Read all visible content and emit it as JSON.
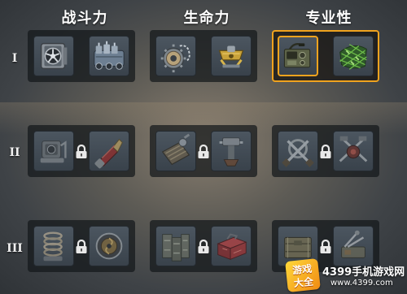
{
  "headers": {
    "combat": "战斗力",
    "survival": "生命力",
    "specialty": "专业性"
  },
  "rows": {
    "r1": "I",
    "r2": "II",
    "r3": "III"
  },
  "selected_slot": "specialty-tier1-left",
  "colors": {
    "selection_border": "#f0a31e",
    "slot_bg": "#434c56",
    "group_bg": "#16191d"
  },
  "icons": {
    "combat_1_left": "turbine-fan-icon",
    "combat_1_right": "ammo-canisters-icon",
    "combat_2_left": "loader-armchair-icon",
    "combat_2_right": "red-shell-icon",
    "combat_3_left": "coil-spring-icon",
    "combat_3_right": "rotor-disc-icon",
    "survival_1_left": "gear-chain-icon",
    "survival_1_right": "gold-clamp-icon",
    "survival_2_left": "track-roller-icon",
    "survival_2_right": "jack-hammer-icon",
    "survival_3_left": "armor-plates-icon",
    "survival_3_right": "red-toolbox-icon",
    "specialty_1_left": "radio-set-icon",
    "specialty_1_right": "camo-net-icon",
    "specialty_2_left": "crossed-tools-icon",
    "specialty_2_right": "repair-kit-icon",
    "specialty_3_left": "supply-crate-icon",
    "specialty_3_right": "field-tools-icon"
  },
  "watermark": {
    "badge_top": "游戏",
    "badge_bottom": "大全",
    "title": "4399手机游戏网",
    "url": "www.4399.com"
  }
}
